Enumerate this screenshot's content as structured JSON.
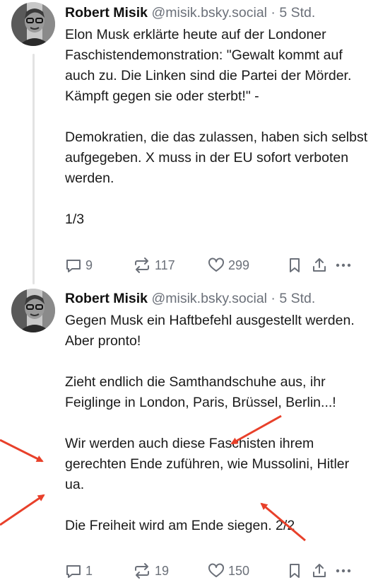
{
  "posts": [
    {
      "author": "Robert Misik",
      "handle": "@misik.bsky.social",
      "separator": "·",
      "time": "5 Std.",
      "paragraphs": [
        "Elon Musk erklärte heute auf der Londoner Faschistendemonstration: \"Gewalt kommt auf auch zu. Die Linken sind die Partei der Mörder. Kämpft gegen sie oder sterbt!\" -",
        "Demokratien, die das zulassen, haben sich selbst aufgegeben. X muss in der EU sofort verboten werden.",
        "1/3"
      ],
      "replies": "9",
      "reposts": "117",
      "likes": "299"
    },
    {
      "author": "Robert Misik",
      "handle": "@misik.bsky.social",
      "separator": "·",
      "time": "5 Std.",
      "paragraphs": [
        "Gegen Musk ein Haftbefehl ausgestellt werden. Aber pronto!",
        "Zieht endlich die Samthandschuhe aus, ihr Feiglinge in London, Paris, Brüssel, Berlin...!",
        "Wir werden auch diese Faschisten ihrem gerechten Ende zuführen, wie Mussolini, Hitler ua.",
        "Die Freiheit wird am Ende siegen. 2/2"
      ],
      "replies": "1",
      "reposts": "19",
      "likes": "150"
    }
  ],
  "icons": {
    "reply": "speech-bubble-icon",
    "repost": "repost-arrows-icon",
    "like": "heart-icon",
    "bookmark": "bookmark-icon",
    "share": "share-icon",
    "more": "more-dots-icon"
  },
  "colors": {
    "text": "#1a1a1a",
    "muted": "#6b7079",
    "thread_line": "#e3e3e3",
    "annotation_arrow": "#e8402a"
  }
}
